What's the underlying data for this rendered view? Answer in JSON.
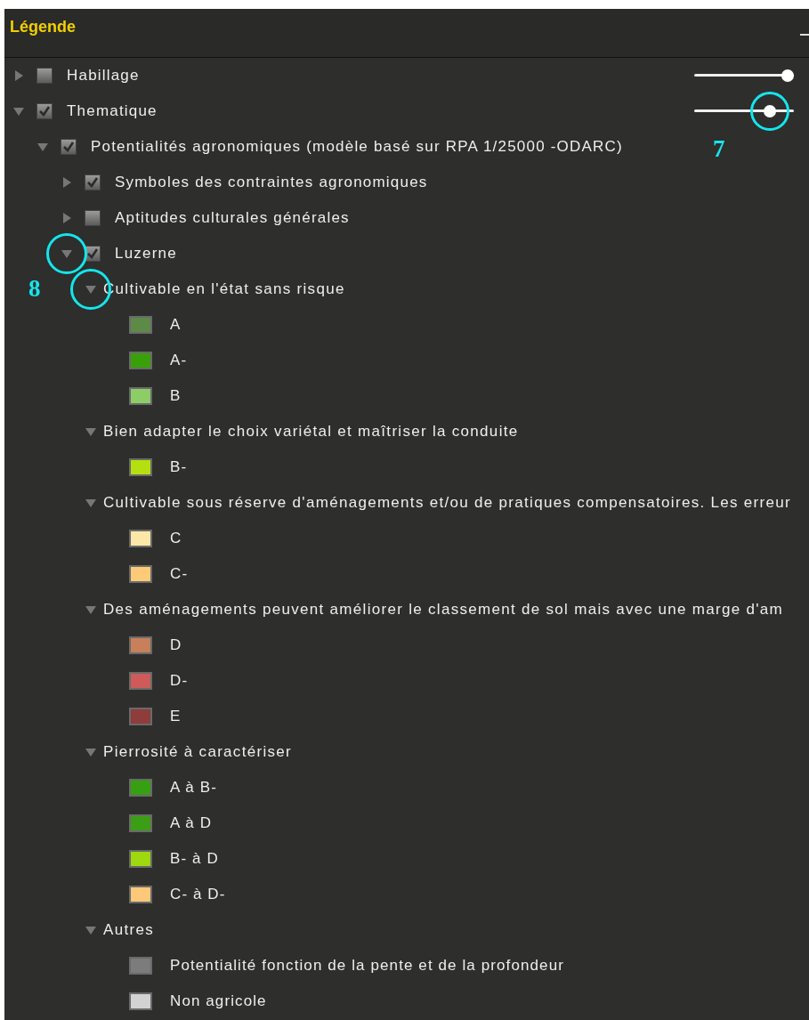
{
  "panel": {
    "title": "Légende"
  },
  "layers": [
    {
      "kind": "layer",
      "label": "Habillage",
      "checked": false,
      "expanded": false,
      "level": 1.0
    },
    {
      "kind": "layer",
      "label": "Thematique",
      "checked": true,
      "expanded": true,
      "level": 0.8,
      "callout": "7",
      "children": [
        {
          "kind": "layer",
          "label": "Potentialités agronomiques (modèle basé sur RPA 1/25000 -ODARC)",
          "checked": true,
          "expanded": true,
          "children": [
            {
              "kind": "layer",
              "label": "Symboles des contraintes agronomiques",
              "checked": true,
              "expanded": false
            },
            {
              "kind": "layer",
              "label": "Aptitudes culturales générales",
              "checked": false,
              "expanded": false
            },
            {
              "kind": "layer",
              "label": "Luzerne",
              "checked": true,
              "expanded": true,
              "circled": true,
              "children": [
                {
                  "kind": "group",
                  "label": "Cultivable en l'état sans risque",
                  "expanded": true,
                  "circled": true,
                  "callout": "8",
                  "children": [
                    {
                      "kind": "class",
                      "label": "A",
                      "color": "#5e8a48"
                    },
                    {
                      "kind": "class",
                      "label": "A-",
                      "color": "#3aa00a"
                    },
                    {
                      "kind": "class",
                      "label": "B",
                      "color": "#8ccd68"
                    }
                  ]
                },
                {
                  "kind": "group",
                  "label": "Bien adapter le choix variétal et maîtriser la conduite",
                  "expanded": true,
                  "children": [
                    {
                      "kind": "class",
                      "label": "B-",
                      "color": "#b4e010"
                    }
                  ]
                },
                {
                  "kind": "group",
                  "label": "Cultivable sous réserve d'aménagements et/ou de pratiques compensatoires. Les erreur",
                  "expanded": true,
                  "children": [
                    {
                      "kind": "class",
                      "label": "C",
                      "color": "#fde7a8"
                    },
                    {
                      "kind": "class",
                      "label": "C-",
                      "color": "#fdcb78"
                    }
                  ]
                },
                {
                  "kind": "group",
                  "label": "Des aménagements peuvent améliorer le classement de sol mais avec une marge d'am",
                  "expanded": true,
                  "children": [
                    {
                      "kind": "class",
                      "label": "D",
                      "color": "#c8805a"
                    },
                    {
                      "kind": "class",
                      "label": "D-",
                      "color": "#cf5a5a"
                    },
                    {
                      "kind": "class",
                      "label": "E",
                      "color": "#8e3c3c"
                    }
                  ]
                },
                {
                  "kind": "group",
                  "label": "Pierrosité à caractériser",
                  "expanded": true,
                  "children": [
                    {
                      "kind": "class",
                      "label": "A à B-",
                      "color": "#35a012"
                    },
                    {
                      "kind": "class",
                      "label": "A à D",
                      "color": "#3c9e14"
                    },
                    {
                      "kind": "class",
                      "label": "B- à D",
                      "color": "#9ed80e"
                    },
                    {
                      "kind": "class",
                      "label": "C- à D-",
                      "color": "#fdc878"
                    }
                  ]
                },
                {
                  "kind": "group",
                  "label": "Autres",
                  "expanded": true,
                  "children": [
                    {
                      "kind": "class",
                      "label": "Potentialité fonction de la pente et de la profondeur",
                      "color": "#7c7c7c"
                    },
                    {
                      "kind": "class",
                      "label": "Non agricole",
                      "color": "#d2d2d2"
                    }
                  ]
                }
              ]
            }
          ]
        }
      ]
    }
  ]
}
